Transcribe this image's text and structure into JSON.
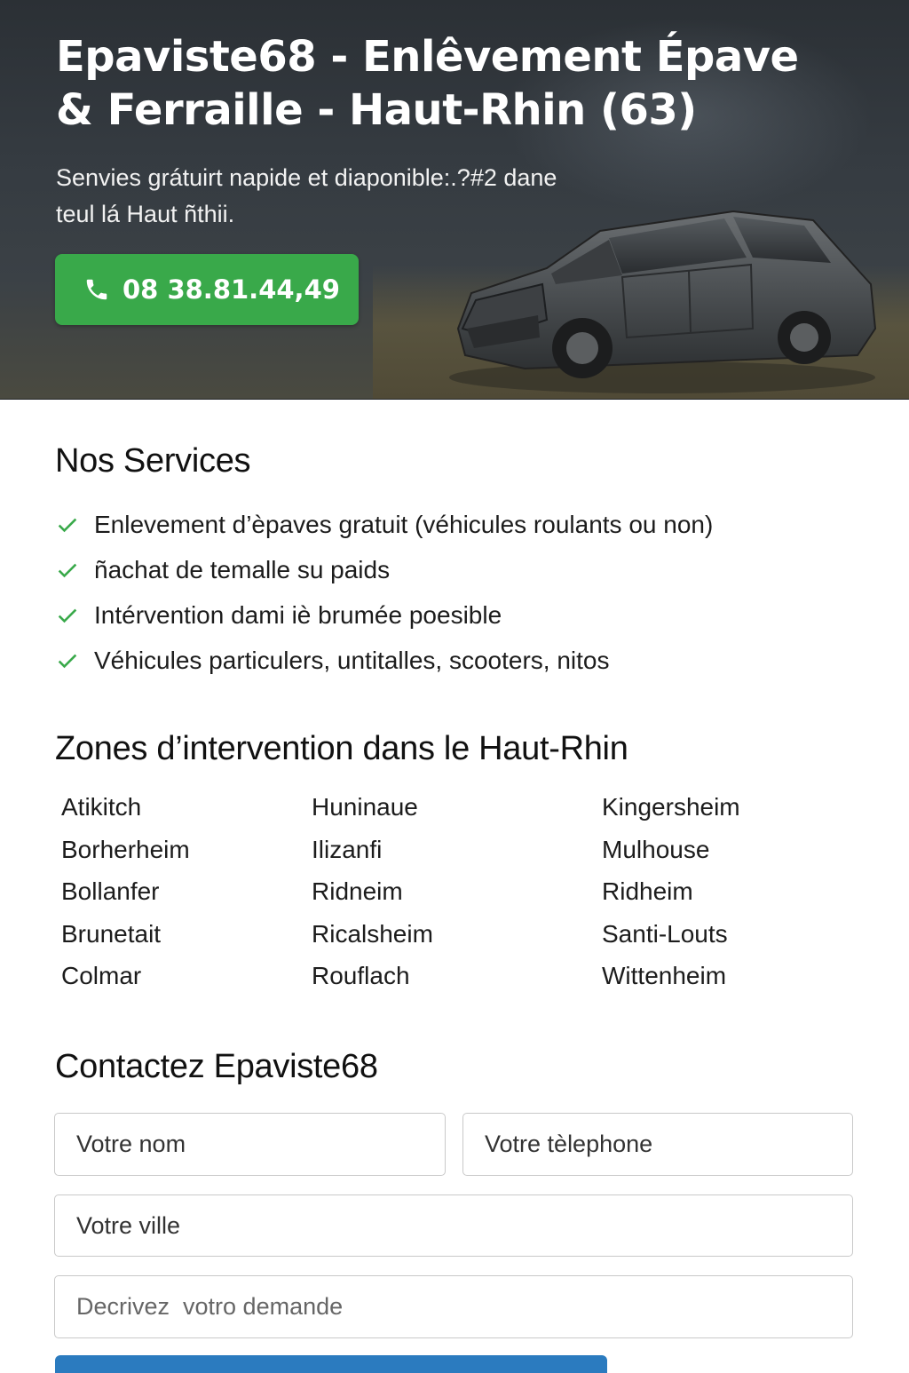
{
  "hero": {
    "title": "Epaviste68 - Enlêvement Épave & Ferraille - Haut-Rhin (63)",
    "subtitle": "Senvies grátuirt napide et diaponible:.?#2 dane teul lá Haut ñthii.",
    "phone_label": "08 38.81.44,49",
    "button_color": "#39a94a"
  },
  "services": {
    "title": "Nos Services",
    "items": [
      "Enlevement d’èpaves gratuit (véhicules roulants ou non)",
      "ñachat de temalle su paids",
      "Intérvention dami iè brumée  poesible",
      "Véhicules particulers, untitalles, scooters, nitos"
    ],
    "check_color": "#39a94a"
  },
  "zones": {
    "title": "Zones d’intervention dans le Haut-Rhin",
    "col1": [
      "Atikitch",
      "Borherheim",
      "Bollanfer",
      "Brunetait",
      "Colmar"
    ],
    "col2": [
      "Huninaue",
      "Ilizanfi",
      "Ridneim",
      "Ricalsheim",
      "Rouflach"
    ],
    "col3": [
      "Kingersheim",
      "Mulhouse",
      "Ridheim",
      "Santi-Louts",
      "Wittenheim"
    ]
  },
  "contact": {
    "title": "Contactez Epaviste68",
    "name_placeholder": "Votre nom",
    "phone_placeholder": "Votre tèlephone",
    "city_placeholder": "Votre ville",
    "message_placeholder": "Decrivez  votro demande",
    "submit_color": "#2b7bbf"
  }
}
